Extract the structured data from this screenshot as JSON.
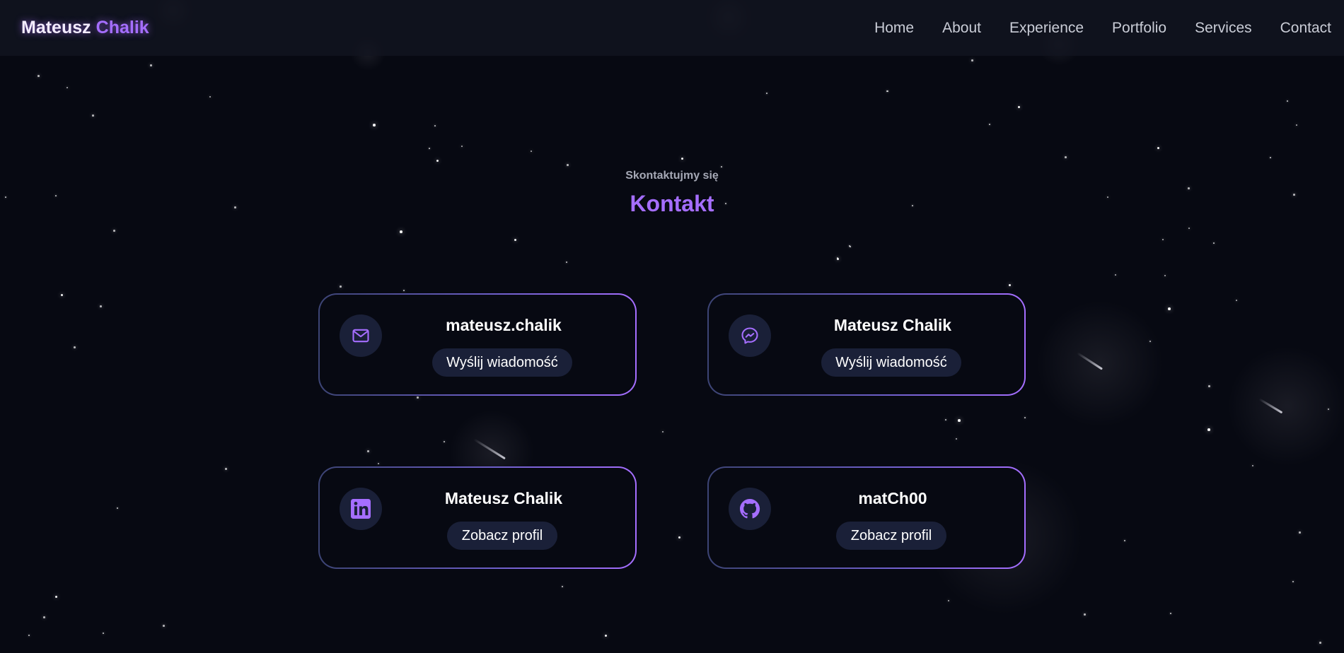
{
  "header": {
    "logo_first": "Mateusz",
    "logo_second": "Chalik",
    "nav": [
      "Home",
      "About",
      "Experience",
      "Portfolio",
      "Services",
      "Contact"
    ]
  },
  "section": {
    "subtitle": "Skontaktujmy się",
    "title": "Kontakt"
  },
  "cards": [
    {
      "icon": "mail-icon",
      "title": "mateusz.chalik",
      "button": "Wyślij wiadomość"
    },
    {
      "icon": "messenger-icon",
      "title": "Mateusz Chalik",
      "button": "Wyślij wiadomość"
    },
    {
      "icon": "linkedin-icon",
      "title": "Mateusz Chalik",
      "button": "Zobacz profil"
    },
    {
      "icon": "github-icon",
      "title": "matCh00",
      "button": "Zobacz profil"
    }
  ],
  "colors": {
    "background": "#070912",
    "accent": "#a56eff",
    "card_border_start": "#3c4474",
    "button_bg": "#1a2038"
  }
}
